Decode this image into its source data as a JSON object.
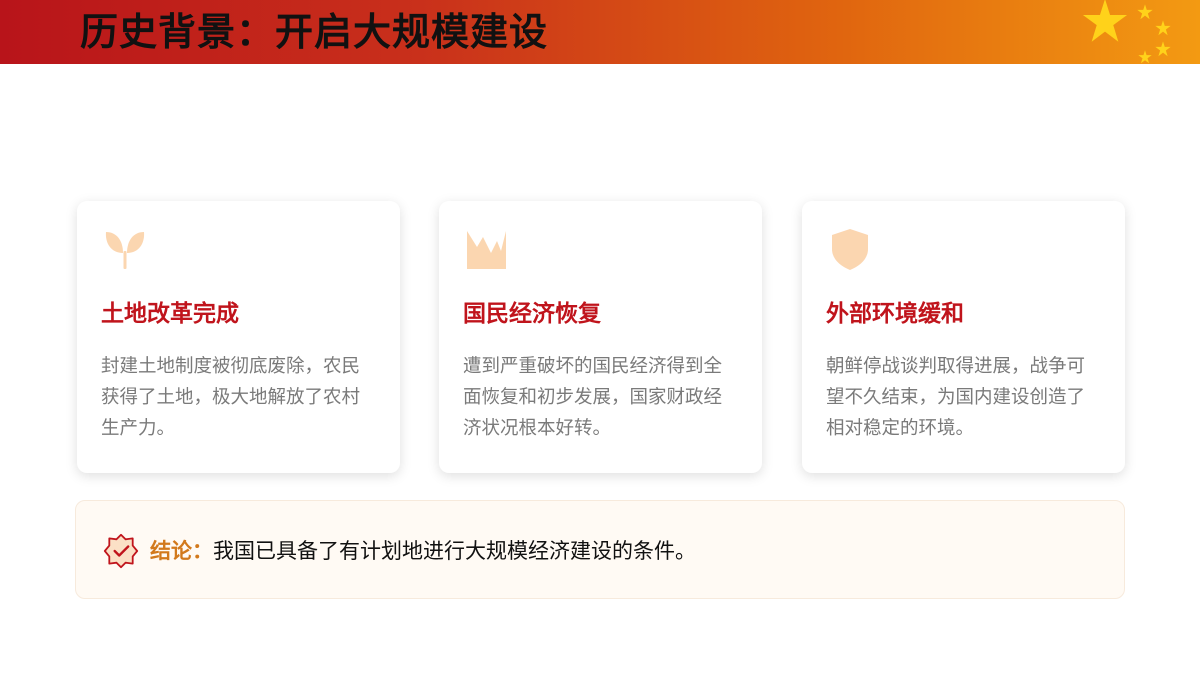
{
  "header": {
    "title": "历史背景：开启大规模建设"
  },
  "cards": [
    {
      "icon": "sprout-icon",
      "title": "土地改革完成",
      "text": "封建土地制度被彻底废除，农民获得了土地，极大地解放了农村生产力。"
    },
    {
      "icon": "broken-chart-icon",
      "title": "国民经济恢复",
      "text": "遭到严重破坏的国民经济得到全面恢复和初步发展，国家财政经济状况根本好转。"
    },
    {
      "icon": "shield-icon",
      "title": "外部环境缓和",
      "text": "朝鲜停战谈判取得进展，战争可望不久结束，为国内建设创造了相对稳定的环境。"
    }
  ],
  "conclusion": {
    "icon": "check-badge-icon",
    "label": "结论：",
    "text": "我国已具备了有计划地进行大规模经济建设的条件。"
  },
  "colors": {
    "accent_red": "#c0141c",
    "icon_peach": "#fbd6b0",
    "conclusion_label": "#d2791c"
  }
}
